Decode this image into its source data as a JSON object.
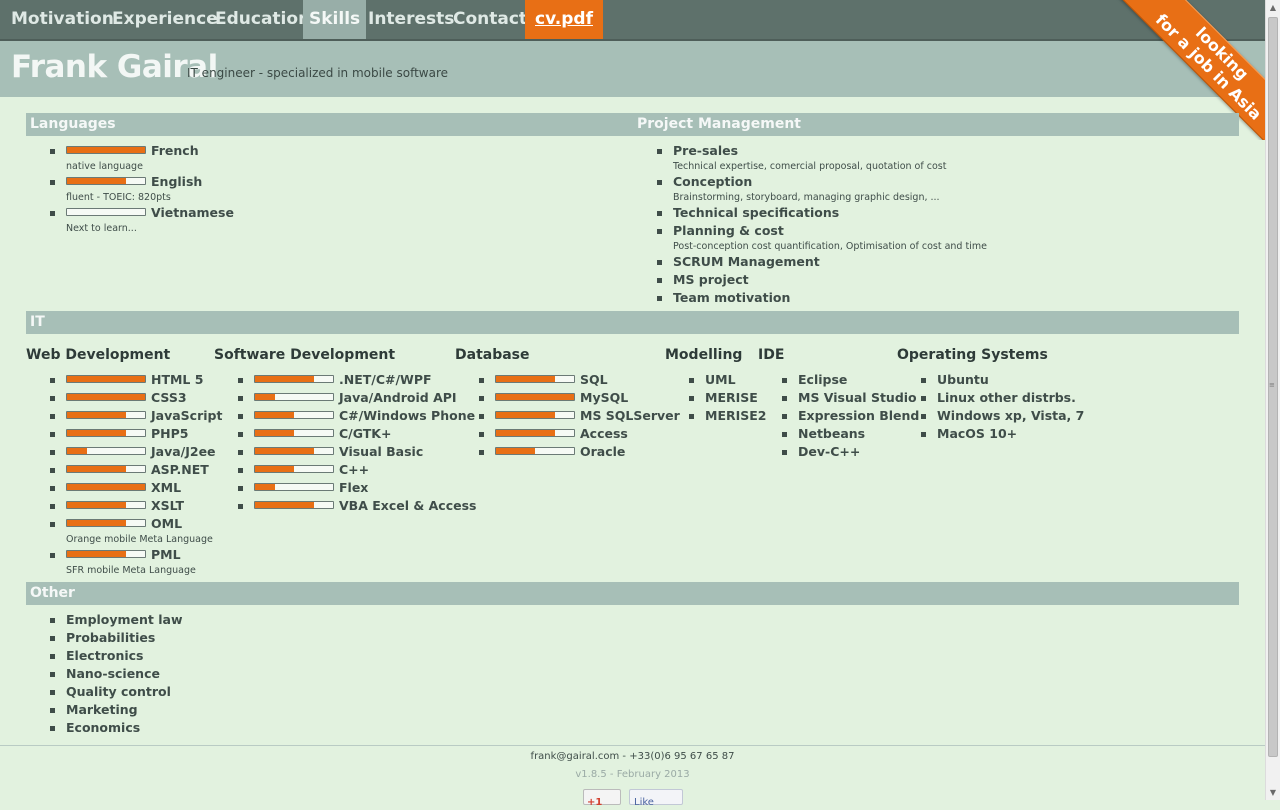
{
  "nav": {
    "items": [
      "Motivation",
      "Experience",
      "Education",
      "Skills",
      "Interests",
      "Contact"
    ],
    "active": "Skills",
    "pdf_label": "cv.pdf"
  },
  "header": {
    "name": "Frank Gairal",
    "tagline": "IT engineer - specialized in mobile software"
  },
  "ribbon": {
    "line1": "looking",
    "line2": "for a job in Asia"
  },
  "sections": {
    "languages": {
      "title": "Languages",
      "items": [
        {
          "label": "French",
          "level": 1.0,
          "note": "native language"
        },
        {
          "label": "English",
          "level": 0.75,
          "note": "fluent - TOEIC: 820pts"
        },
        {
          "label": "Vietnamese",
          "level": 0.0,
          "note": "Next to learn..."
        }
      ]
    },
    "project_management": {
      "title": "Project Management",
      "items": [
        {
          "label": "Pre-sales",
          "note": "Technical expertise, comercial proposal, quotation of cost"
        },
        {
          "label": "Conception",
          "note": "Brainstorming, storyboard, managing graphic design, ..."
        },
        {
          "label": "Technical specifications"
        },
        {
          "label": "Planning & cost",
          "note": "Post-conception cost quantification, Optimisation of cost and time"
        },
        {
          "label": "SCRUM Management"
        },
        {
          "label": "MS project"
        },
        {
          "label": "Team motivation"
        }
      ]
    },
    "it": {
      "title": "IT",
      "web": {
        "title": "Web Development",
        "items": [
          {
            "label": "HTML 5",
            "level": 1.0
          },
          {
            "label": "CSS3",
            "level": 1.0
          },
          {
            "label": "JavaScript",
            "level": 0.75
          },
          {
            "label": "PHP5",
            "level": 0.75
          },
          {
            "label": "Java/J2ee",
            "level": 0.25
          },
          {
            "label": "ASP.NET",
            "level": 0.75
          },
          {
            "label": "XML",
            "level": 1.0
          },
          {
            "label": "XSLT",
            "level": 0.75
          },
          {
            "label": "OML",
            "level": 0.75,
            "note": "Orange mobile Meta Language"
          },
          {
            "label": "PML",
            "level": 0.75,
            "note": "SFR mobile Meta Language"
          }
        ]
      },
      "software": {
        "title": "Software Development",
        "items": [
          {
            "label": ".NET/C#/WPF",
            "level": 0.75
          },
          {
            "label": "Java/Android API",
            "level": 0.25
          },
          {
            "label": "C#/Windows Phone",
            "level": 0.5
          },
          {
            "label": "C/GTK+",
            "level": 0.5
          },
          {
            "label": "Visual Basic",
            "level": 0.75
          },
          {
            "label": "C++",
            "level": 0.5
          },
          {
            "label": "Flex",
            "level": 0.25
          },
          {
            "label": "VBA Excel & Access",
            "level": 0.75
          }
        ]
      },
      "database": {
        "title": "Database",
        "items": [
          {
            "label": "SQL",
            "level": 0.75
          },
          {
            "label": "MySQL",
            "level": 1.0
          },
          {
            "label": "MS SQLServer",
            "level": 0.75
          },
          {
            "label": "Access",
            "level": 0.75
          },
          {
            "label": "Oracle",
            "level": 0.5
          }
        ]
      },
      "modelling": {
        "title": "Modelling",
        "items": [
          {
            "label": "UML"
          },
          {
            "label": "MERISE"
          },
          {
            "label": "MERISE2"
          }
        ]
      },
      "ide": {
        "title": "IDE",
        "items": [
          {
            "label": "Eclipse"
          },
          {
            "label": "MS Visual Studio"
          },
          {
            "label": "Expression Blend"
          },
          {
            "label": "Netbeans"
          },
          {
            "label": "Dev-C++"
          }
        ]
      },
      "os": {
        "title": "Operating Systems",
        "items": [
          {
            "label": "Ubuntu"
          },
          {
            "label": "Linux other distrbs."
          },
          {
            "label": "Windows xp, Vista, 7"
          },
          {
            "label": "MacOS 10+"
          }
        ]
      }
    },
    "other": {
      "title": "Other",
      "items": [
        {
          "label": "Employment law"
        },
        {
          "label": "Probabilities"
        },
        {
          "label": "Electronics"
        },
        {
          "label": "Nano-science"
        },
        {
          "label": "Quality control"
        },
        {
          "label": "Marketing"
        },
        {
          "label": "Economics"
        }
      ]
    }
  },
  "footer": {
    "contact": "frank@gairal.com - +33(0)6 95 67 65 87",
    "version": "v1.8.5 - February 2013",
    "gplus_label": "+1",
    "like_label": "Like"
  },
  "colors": {
    "accent": "#e86f15",
    "bar": "#a7bfb7",
    "nav": "#5e716b",
    "background": "#e2f2df"
  }
}
